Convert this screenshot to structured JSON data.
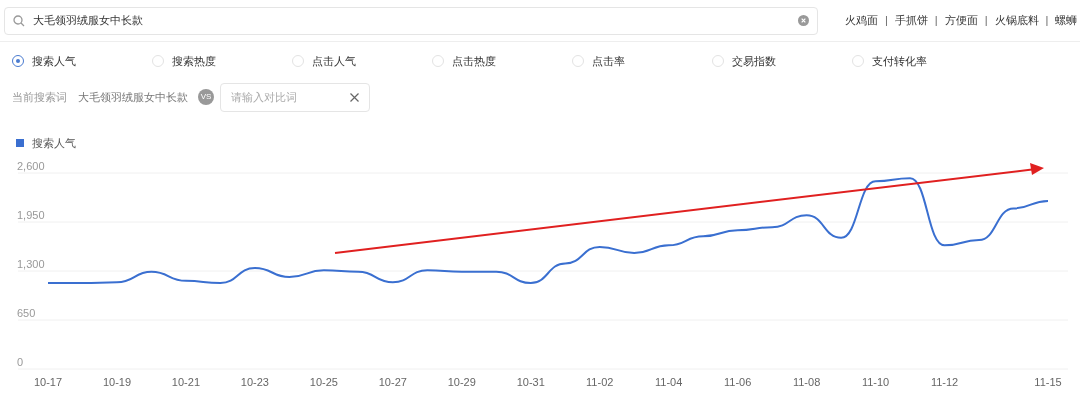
{
  "search": {
    "value": "大毛领羽绒服女中长款"
  },
  "hot_words": [
    "火鸡面",
    "手抓饼",
    "方便面",
    "火锅底料",
    "螺蛳"
  ],
  "hot_separator": "|",
  "metrics": [
    {
      "label": "搜索人气",
      "selected": true
    },
    {
      "label": "搜索热度",
      "selected": false
    },
    {
      "label": "点击人气",
      "selected": false
    },
    {
      "label": "点击热度",
      "selected": false
    },
    {
      "label": "点击率",
      "selected": false
    },
    {
      "label": "交易指数",
      "selected": false
    },
    {
      "label": "支付转化率",
      "selected": false
    }
  ],
  "compare": {
    "label": "当前搜索词",
    "keyword": "大毛领羽绒服女中长款",
    "vs": "VS",
    "placeholder": "请输入对比词"
  },
  "chart": {
    "trend_arrow": {
      "color": "#e02020"
    },
    "chart_data": {
      "type": "line",
      "categories": [
        "10-17",
        null,
        "10-19",
        null,
        "10-21",
        null,
        "10-23",
        null,
        "10-25",
        null,
        "10-27",
        null,
        "10-29",
        null,
        "10-31",
        null,
        "11-02",
        null,
        "11-04",
        null,
        "11-06",
        null,
        "11-08",
        null,
        "11-10",
        null,
        "11-12",
        null,
        null,
        "11-15"
      ],
      "series": [
        {
          "name": "搜索人气",
          "color": "#3a6fd0",
          "values": [
            1140,
            1140,
            1150,
            1290,
            1170,
            1140,
            1340,
            1220,
            1310,
            1290,
            1150,
            1310,
            1290,
            1290,
            1140,
            1400,
            1620,
            1540,
            1640,
            1760,
            1840,
            1880,
            2040,
            1740,
            2490,
            2530,
            1640,
            1710,
            2130,
            2230
          ]
        }
      ],
      "grid": true,
      "ylim": [
        0,
        2600
      ],
      "yticks": [
        {
          "value": 0,
          "label": "0"
        },
        {
          "value": 650,
          "label": "650"
        },
        {
          "value": 1300,
          "label": "1,300"
        },
        {
          "value": 1950,
          "label": "1,950"
        },
        {
          "value": 2600,
          "label": "2,600"
        }
      ]
    }
  }
}
